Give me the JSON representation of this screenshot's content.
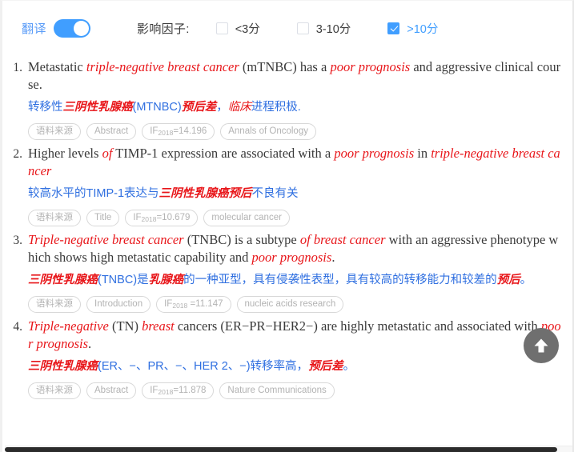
{
  "toolbar": {
    "translate_label": "翻译",
    "translate_on": true,
    "impact_factor_label": "影响因子:",
    "filters": [
      {
        "label": "<3分",
        "checked": false
      },
      {
        "label": "3-10分",
        "checked": false
      },
      {
        "label": ">10分",
        "checked": true
      }
    ]
  },
  "results": [
    {
      "index": "1.",
      "en_html": "Metastatic <em>triple-negative breast cancer</em> (mTNBC) has a <em>poor prognosis</em> and aggressive clinical course.",
      "zh_html": "转移性<em>三阴性乳腺癌</em>(MTNBC)<em>预后差</em>，<i>临床</i>进程积极.",
      "chips": [
        {
          "name": "source-label",
          "text": "语料来源"
        },
        {
          "name": "section",
          "text": "Abstract"
        },
        {
          "name": "impact-factor",
          "text": "IF",
          "sub": "2018",
          "suffix": "=14.196"
        },
        {
          "name": "journal",
          "text": "Annals of Oncology"
        }
      ]
    },
    {
      "index": "2.",
      "en_html": "Higher levels <em>of</em> TIMP-1 expression are associated with a <em>poor prognosis</em> in <em>triple-negative breast cancer</em>",
      "zh_html": "较高水平的TIMP-1表达与<em>三阴性乳腺癌预后</em>不良有关",
      "chips": [
        {
          "name": "source-label",
          "text": "语料来源"
        },
        {
          "name": "section",
          "text": "Title"
        },
        {
          "name": "impact-factor",
          "text": "IF",
          "sub": "2018",
          "suffix": "=10.679"
        },
        {
          "name": "journal",
          "text": "molecular cancer"
        }
      ]
    },
    {
      "index": "3.",
      "en_html": "<em>Triple-negative breast cancer</em> (TNBC) is a subtype <em>of breast cancer</em> with an aggressive phenotype which shows high metastatic capability and <em>poor prognosis</em>.",
      "zh_html": "<em>三阴性乳腺癌</em>(TNBC)是<em>乳腺癌</em>的一种亚型，具有侵袭性表型，具有较高的转移能力和较差的<em>预后</em>。",
      "chips": [
        {
          "name": "source-label",
          "text": "语料来源"
        },
        {
          "name": "section",
          "text": "Introduction"
        },
        {
          "name": "impact-factor",
          "text": "IF",
          "sub": "2018",
          "suffix": " =11.147"
        },
        {
          "name": "journal",
          "text": "nucleic acids research"
        }
      ]
    },
    {
      "index": "4.",
      "en_html": "<em>Triple-negative</em> (TN) <em>breast</em> cancers (ER−PR−HER2−) are highly metastatic and associated with <em>poor prognosis</em>.",
      "zh_html": "<em>三阴性乳腺癌</em>(ER、−、PR、−、HER 2、−)转移率高，<em>预后差</em>。",
      "chips": [
        {
          "name": "source-label",
          "text": "语料来源"
        },
        {
          "name": "section",
          "text": "Abstract"
        },
        {
          "name": "impact-factor",
          "text": "IF",
          "sub": "2018",
          "suffix": "=11.878"
        },
        {
          "name": "journal",
          "text": "Nature Communications"
        }
      ]
    }
  ],
  "back_to_top": {
    "icon": "arrow-up-icon"
  },
  "colors": {
    "accent": "#409eff",
    "highlight": "#e8161a",
    "translation": "#2f6fe0",
    "chip_text": "#b3b3b3"
  }
}
